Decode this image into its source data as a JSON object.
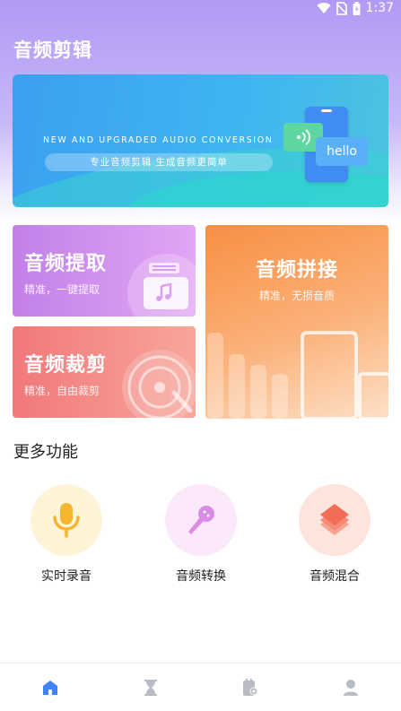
{
  "status_bar": {
    "time": "1:37",
    "icons": [
      "wifi-icon",
      "no-sim-icon",
      "battery-icon"
    ]
  },
  "app": {
    "title": "音频剪辑"
  },
  "banner": {
    "headline_en": "NEW AND UPGRADED AUDIO CONVERSION",
    "tagline": "专业音频剪辑   生成音频更简单",
    "bubble_text": "hello"
  },
  "cards": {
    "extract": {
      "title": "音频提取",
      "subtitle": "精准，一键提取"
    },
    "cut": {
      "title": "音频裁剪",
      "subtitle": "精准，自由裁剪"
    },
    "join": {
      "title": "音频拼接",
      "subtitle": "精准，无损音质"
    }
  },
  "more": {
    "title": "更多功能",
    "items": [
      {
        "label": "实时录音",
        "icon": "microphone-icon"
      },
      {
        "label": "音频转换",
        "icon": "karaoke-mic-icon"
      },
      {
        "label": "音频混合",
        "icon": "layers-icon"
      }
    ]
  },
  "bottom_nav": {
    "items": [
      {
        "icon": "home-icon",
        "active": true
      },
      {
        "icon": "hourglass-icon",
        "active": false
      },
      {
        "icon": "document-add-icon",
        "active": false
      },
      {
        "icon": "user-icon",
        "active": false
      }
    ]
  },
  "colors": {
    "header_gradient": "#b19af5",
    "banner_blue": "#3aa0f0",
    "card_extract": "#c280e9",
    "card_cut": "#f2787a",
    "card_join": "#f88f43",
    "nav_active": "#3f82f6",
    "nav_inactive": "#b8bcc4"
  }
}
